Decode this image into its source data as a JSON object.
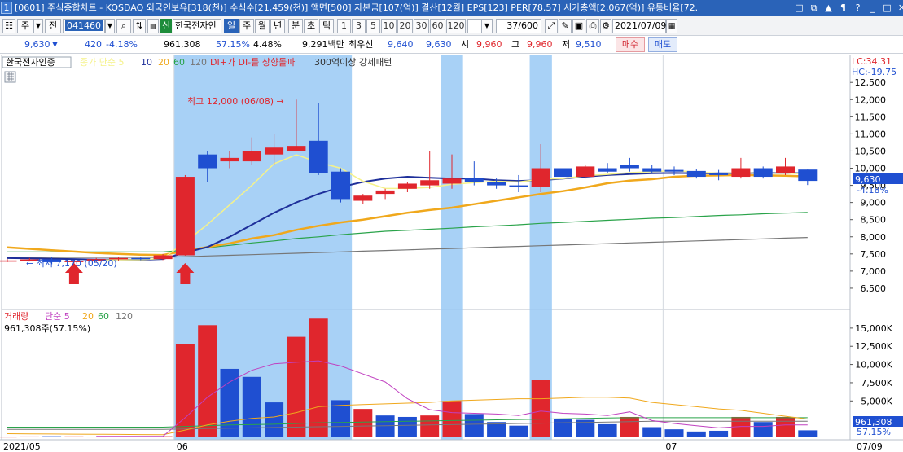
{
  "titlebar": {
    "window_number": "1",
    "title": "[0601] 주식종합차트 - KOSDAQ 외국인보유[318(천)] 수식수[21,459(천)] 액면[500] 자본금[107(억)] 결산[12월] EPS[123] PER[78.57] 시가총액[2,067(억)] 유통비율[72.",
    "controls": [
      "□",
      "⧉",
      "▲",
      "¶",
      "?",
      "_",
      "□",
      "✕"
    ]
  },
  "toolbar": {
    "period_type": "주",
    "prev_label": "전",
    "code": "041460",
    "credit_badge": "신",
    "stock_name": "한국전자인",
    "intervals": [
      "일",
      "주",
      "월",
      "년",
      "분",
      "초",
      "틱"
    ],
    "selected_interval": "일",
    "ticks": [
      "1",
      "3",
      "5",
      "10",
      "20",
      "30",
      "60",
      "120"
    ],
    "count": "37/600",
    "date": "2021/07/09"
  },
  "quote": {
    "price": "9,630",
    "change": "420",
    "change_pct": "-4.18%",
    "volume": "961,308",
    "volume_ratio": "57.15%",
    "turnover_pct": "4.48%",
    "amount": "9,291백만",
    "best_ask_label": "최우선",
    "best_ask": "9,640",
    "best_bid": "9,630",
    "open_label": "시",
    "open": "9,960",
    "high_label": "고",
    "high": "9,960",
    "low_label": "저",
    "low": "9,510",
    "buy_label": "매수",
    "sell_label": "매도"
  },
  "colors": {
    "up": "#e0262d",
    "down": "#1f4fd1",
    "highlight": "#99c9f5",
    "ma5": "#f5f28a",
    "ma10": "#1e2f9a",
    "ma20": "#f0a81c",
    "ma60": "#2aa34a",
    "ma120": "#777777",
    "vol_ma5": "#c040c0"
  },
  "price_panel": {
    "tag": "한국전자인증",
    "legend": [
      {
        "text": "종가 단순 5",
        "color": "#f5f28a"
      },
      {
        "text": "10",
        "color": "#1e2f9a"
      },
      {
        "text": "20",
        "color": "#f0a81c"
      },
      {
        "text": "60",
        "color": "#2aa34a"
      },
      {
        "text": "120",
        "color": "#777777"
      },
      {
        "text": "DI+가 DI-를 상향돌파",
        "color": "#e0262d"
      },
      {
        "text": "300억이상 강세패턴",
        "color": "#333333"
      }
    ],
    "lc": "LC:34.31",
    "hc": "HC:-19.75",
    "high_note": "최고 12,000 (06/08) →",
    "low_note": "← 최저 7,170 (05/20)",
    "price_tag": "9,630",
    "price_change_tag": "-4.18%"
  },
  "volume_panel": {
    "legend": [
      {
        "text": "거래량",
        "color": "#e0262d"
      },
      {
        "text": "단순 5",
        "color": "#c040c0"
      },
      {
        "text": "20",
        "color": "#f0a81c"
      },
      {
        "text": "60",
        "color": "#2aa34a"
      },
      {
        "text": "120",
        "color": "#777777"
      }
    ],
    "current": "961,308주(57.15%)",
    "volume_tag": "961,308",
    "volume_ratio_tag": "57.15%"
  },
  "x_axis": {
    "labels": [
      {
        "i": 0,
        "text": "2021/05"
      },
      {
        "i": 8,
        "text": "06"
      },
      {
        "i": 30,
        "text": "07"
      }
    ],
    "end_label": "07/09"
  },
  "chart_data": {
    "type": "candlestick",
    "price_axis": {
      "min": 6000,
      "max": 12600,
      "ticks": [
        6500,
        7000,
        7500,
        8000,
        8500,
        9000,
        9500,
        10000,
        10500,
        11000,
        11500,
        12000,
        12500
      ]
    },
    "volume_axis": {
      "min": 0,
      "max": 17000000,
      "ticks": [
        5000000,
        7500000,
        10000000,
        12500000,
        15000000
      ],
      "tick_labels": [
        "5,000K",
        "7,500K",
        "10,000K",
        "12,500K",
        "15,000K"
      ]
    },
    "highlight_ranges": [
      [
        8,
        15
      ],
      [
        20,
        20
      ],
      [
        24,
        24
      ]
    ],
    "signal_arrows": [
      3,
      8
    ],
    "candles": [
      {
        "o": 7300,
        "h": 7350,
        "l": 7260,
        "c": 7310
      },
      {
        "o": 7320,
        "h": 7380,
        "l": 7280,
        "c": 7340
      },
      {
        "o": 7340,
        "h": 7400,
        "l": 7200,
        "c": 7260
      },
      {
        "o": 7260,
        "h": 7320,
        "l": 7170,
        "c": 7300
      },
      {
        "o": 7300,
        "h": 7380,
        "l": 7250,
        "c": 7350
      },
      {
        "o": 7350,
        "h": 7420,
        "l": 7310,
        "c": 7380
      },
      {
        "o": 7380,
        "h": 7420,
        "l": 7320,
        "c": 7350
      },
      {
        "o": 7350,
        "h": 7500,
        "l": 7320,
        "c": 7460
      },
      {
        "o": 7460,
        "h": 9800,
        "l": 7450,
        "c": 9750
      },
      {
        "o": 10400,
        "h": 10500,
        "l": 9600,
        "c": 10000
      },
      {
        "o": 10200,
        "h": 10500,
        "l": 10000,
        "c": 10300
      },
      {
        "o": 10200,
        "h": 10900,
        "l": 10100,
        "c": 10500
      },
      {
        "o": 10400,
        "h": 11000,
        "l": 10100,
        "c": 10600
      },
      {
        "o": 10500,
        "h": 12000,
        "l": 10500,
        "c": 10650
      },
      {
        "o": 10800,
        "h": 11900,
        "l": 9800,
        "c": 9850
      },
      {
        "o": 9900,
        "h": 10000,
        "l": 9000,
        "c": 9100
      },
      {
        "o": 9050,
        "h": 9250,
        "l": 8950,
        "c": 9200
      },
      {
        "o": 9250,
        "h": 9400,
        "l": 9100,
        "c": 9350
      },
      {
        "o": 9400,
        "h": 9600,
        "l": 9300,
        "c": 9550
      },
      {
        "o": 9500,
        "h": 10500,
        "l": 9400,
        "c": 9650
      },
      {
        "o": 9550,
        "h": 10400,
        "l": 9400,
        "c": 9700
      },
      {
        "o": 9700,
        "h": 10200,
        "l": 9500,
        "c": 9600
      },
      {
        "o": 9600,
        "h": 9700,
        "l": 9400,
        "c": 9500
      },
      {
        "o": 9500,
        "h": 9800,
        "l": 9300,
        "c": 9450
      },
      {
        "o": 9450,
        "h": 10700,
        "l": 9300,
        "c": 10000
      },
      {
        "o": 10000,
        "h": 10350,
        "l": 9750,
        "c": 9750
      },
      {
        "o": 9750,
        "h": 10100,
        "l": 9700,
        "c": 10050
      },
      {
        "o": 10000,
        "h": 10150,
        "l": 9850,
        "c": 9900
      },
      {
        "o": 10100,
        "h": 10300,
        "l": 9900,
        "c": 10000
      },
      {
        "o": 10000,
        "h": 10100,
        "l": 9850,
        "c": 9900
      },
      {
        "o": 9950,
        "h": 10050,
        "l": 9800,
        "c": 9900
      },
      {
        "o": 9920,
        "h": 9980,
        "l": 9700,
        "c": 9750
      },
      {
        "o": 9850,
        "h": 9950,
        "l": 9650,
        "c": 9800
      },
      {
        "o": 9750,
        "h": 10300,
        "l": 9700,
        "c": 10000
      },
      {
        "o": 10000,
        "h": 10050,
        "l": 9700,
        "c": 9750
      },
      {
        "o": 9850,
        "h": 10300,
        "l": 9800,
        "c": 10050
      },
      {
        "o": 9960,
        "h": 9960,
        "l": 9510,
        "c": 9630
      }
    ],
    "volumes": [
      100000,
      120000,
      150000,
      130000,
      110000,
      140000,
      160000,
      150000,
      12800000,
      15400000,
      9400000,
      8300000,
      4800000,
      13800000,
      16300000,
      5100000,
      3900000,
      3000000,
      2800000,
      3000000,
      5000000,
      3200000,
      2100000,
      1600000,
      7900000,
      2500000,
      2400000,
      1800000,
      2800000,
      1400000,
      1100000,
      800000,
      900000,
      2800000,
      2100000,
      2800000,
      961308
    ],
    "volume_up": [
      true,
      true,
      false,
      true,
      true,
      true,
      false,
      true,
      true,
      true,
      false,
      false,
      false,
      true,
      true,
      false,
      true,
      false,
      false,
      true,
      true,
      false,
      false,
      false,
      true,
      false,
      false,
      false,
      true,
      false,
      false,
      false,
      false,
      true,
      false,
      true,
      false
    ],
    "ma5": [
      null,
      null,
      null,
      null,
      7320,
      7330,
      7330,
      7370,
      7840,
      8360,
      8930,
      9500,
      10130,
      10390,
      10170,
      10000,
      9620,
      9410,
      9410,
      9440,
      9530,
      9580,
      9620,
      9600,
      9680,
      9700,
      9780,
      9820,
      9870,
      9900,
      9930,
      9890,
      9850,
      9870,
      9850,
      9860,
      9830
    ],
    "ma10": [
      7380,
      7370,
      7360,
      7350,
      7340,
      7340,
      7330,
      7350,
      7540,
      7700,
      8000,
      8350,
      8700,
      9000,
      9250,
      9450,
      9600,
      9700,
      9750,
      9720,
      9700,
      9700,
      9650,
      9630,
      9650,
      9700,
      9750,
      9800,
      9830,
      9850,
      9860,
      9850,
      9850,
      9860,
      9860,
      9860,
      9850
    ],
    "ma20": [
      7690,
      7650,
      7610,
      7570,
      7530,
      7500,
      7480,
      7470,
      7590,
      7700,
      7810,
      7950,
      8050,
      8200,
      8320,
      8420,
      8500,
      8600,
      8700,
      8780,
      8850,
      8950,
      9050,
      9150,
      9250,
      9330,
      9440,
      9560,
      9640,
      9680,
      9750,
      9780,
      9790,
      9800,
      9790,
      9780,
      9760
    ],
    "ma60": [
      7560,
      7560,
      7560,
      7560,
      7560,
      7560,
      7560,
      7560,
      7610,
      7680,
      7750,
      7820,
      7880,
      7950,
      8000,
      8060,
      8110,
      8160,
      8190,
      8220,
      8250,
      8290,
      8320,
      8350,
      8390,
      8420,
      8450,
      8480,
      8510,
      8540,
      8560,
      8590,
      8620,
      8640,
      8670,
      8690,
      8710
    ],
    "ma120": [
      7400,
      7400,
      7400,
      7400,
      7400,
      7400,
      7400,
      7400,
      7420,
      7440,
      7460,
      7480,
      7500,
      7520,
      7540,
      7560,
      7580,
      7600,
      7620,
      7640,
      7660,
      7680,
      7700,
      7720,
      7740,
      7760,
      7780,
      7800,
      7820,
      7840,
      7860,
      7880,
      7900,
      7920,
      7940,
      7960,
      7980
    ],
    "vol_ma5": [
      null,
      null,
      null,
      null,
      130000,
      140000,
      140000,
      140000,
      2700000,
      5500000,
      7600000,
      9200000,
      10100000,
      10300000,
      10500000,
      9800000,
      8700000,
      7600000,
      5300000,
      3800000,
      3400000,
      3300000,
      3200000,
      3000000,
      3600000,
      3300000,
      3200000,
      3000000,
      3500000,
      2300000,
      1900000,
      1600000,
      1300000,
      1500000,
      1500000,
      1700000,
      1700000
    ],
    "vol_ma20": [
      500000,
      480000,
      460000,
      440000,
      420000,
      400000,
      380000,
      360000,
      1000000,
      1700000,
      2200000,
      2600000,
      2800000,
      3400000,
      4200000,
      4400000,
      4500000,
      4600000,
      4700000,
      4800000,
      5000000,
      5100000,
      5200000,
      5300000,
      5300000,
      5400000,
      5500000,
      5500000,
      5400000,
      4800000,
      4500000,
      4200000,
      3900000,
      3700000,
      3300000,
      2900000,
      2500000
    ],
    "vol_ma60": [
      1400000,
      1400000,
      1400000,
      1400000,
      1400000,
      1400000,
      1400000,
      1400000,
      1500000,
      1600000,
      1700000,
      1750000,
      1800000,
      1900000,
      2000000,
      2050000,
      2100000,
      2150000,
      2200000,
      2250000,
      2300000,
      2350000,
      2400000,
      2450000,
      2500000,
      2550000,
      2600000,
      2650000,
      2700000,
      2700000,
      2700000,
      2700000,
      2700000,
      2700000,
      2700000,
      2700000,
      2700000
    ],
    "vol_ma120": [
      1100000,
      1100000,
      1100000,
      1100000,
      1100000,
      1100000,
      1100000,
      1100000,
      1150000,
      1200000,
      1250000,
      1300000,
      1350000,
      1400000,
      1450000,
      1500000,
      1550000,
      1600000,
      1650000,
      1700000,
      1750000,
      1800000,
      1850000,
      1900000,
      1950000,
      2000000,
      2050000,
      2100000,
      2150000,
      2200000,
      2200000,
      2200000,
      2200000,
      2200000,
      2200000,
      2200000,
      2200000
    ]
  }
}
